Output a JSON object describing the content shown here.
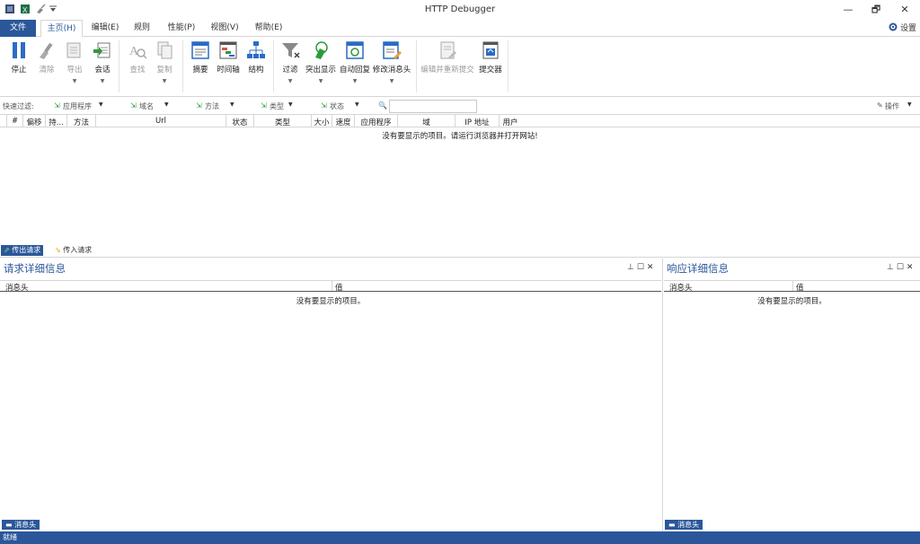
{
  "window": {
    "title": "HTTP Debugger"
  },
  "window_controls": [
    "—",
    "🗗",
    "✕"
  ],
  "tabs": [
    {
      "label": "文件",
      "type": "file"
    },
    {
      "label": "主页(H)",
      "active": true
    },
    {
      "label": "编辑(E)"
    },
    {
      "label": "规则"
    },
    {
      "label": "性能(P)"
    },
    {
      "label": "视图(V)"
    },
    {
      "label": "帮助(E)"
    }
  ],
  "settings": {
    "label": "设置",
    "icon": "gear-icon"
  },
  "ribbon": [
    {
      "label": "停止",
      "icon": "pause-icon",
      "enabled": true
    },
    {
      "label": "清除",
      "icon": "brush-icon",
      "enabled": false
    },
    {
      "label": "导出",
      "icon": "export-icon",
      "enabled": false,
      "dropdown": true
    },
    {
      "label": "会话",
      "icon": "session-icon",
      "enabled": true,
      "dropdown": true
    },
    {
      "label": "查找",
      "icon": "find-icon",
      "enabled": false
    },
    {
      "label": "复制",
      "icon": "copy-icon",
      "enabled": false,
      "dropdown": true
    },
    {
      "label": "摘要",
      "icon": "summary-icon",
      "enabled": true
    },
    {
      "label": "时间轴",
      "icon": "timeline-icon",
      "enabled": true
    },
    {
      "label": "结构",
      "icon": "structure-icon",
      "enabled": true
    },
    {
      "label": "过滤",
      "icon": "filter-icon",
      "enabled": true,
      "dropdown": true
    },
    {
      "label": "突出显示",
      "icon": "highlight-icon",
      "enabled": true,
      "dropdown": true
    },
    {
      "label": "自动回复",
      "icon": "auto-reply-icon",
      "enabled": true,
      "dropdown": true
    },
    {
      "label": "修改消息头",
      "icon": "edit-header-icon",
      "enabled": true,
      "dropdown": true
    },
    {
      "label": "编辑并重新提交",
      "icon": "edit-resubmit-icon",
      "enabled": false
    },
    {
      "label": "提交器",
      "icon": "submitter-icon",
      "enabled": true
    }
  ],
  "filter_row": {
    "label": "快速过滤:",
    "filters": [
      "应用程序",
      "域名",
      "方法",
      "类型",
      "状态"
    ],
    "search_value": "",
    "actions_label": "操作"
  },
  "grid_columns": [
    "#",
    "偏移",
    "持...",
    "方法",
    "Url",
    "状态",
    "类型",
    "大小",
    "速度",
    "应用程序",
    "域",
    "IP 地址",
    "用户"
  ],
  "grid_empty_message": "没有要显示的项目。请运行浏览器并打开网站!",
  "bottom_tabs": [
    {
      "label": "传出请求",
      "active": true
    },
    {
      "label": "传入请求",
      "active": false
    }
  ],
  "request_panel": {
    "title": "请求详细信息",
    "columns": [
      "消息头",
      "值"
    ],
    "empty_message": "没有要显示的项目。",
    "footer_tab": "消息头"
  },
  "response_panel": {
    "title": "响应详细信息",
    "columns": [
      "消息头",
      "值"
    ],
    "empty_message": "没有要显示的项目。",
    "footer_tab": "消息头"
  },
  "panel_controls": [
    "📌",
    "☐",
    "✕"
  ],
  "status": {
    "text": "就绪"
  },
  "colors": {
    "accent": "#2b579a",
    "border": "#d6d6d6"
  }
}
